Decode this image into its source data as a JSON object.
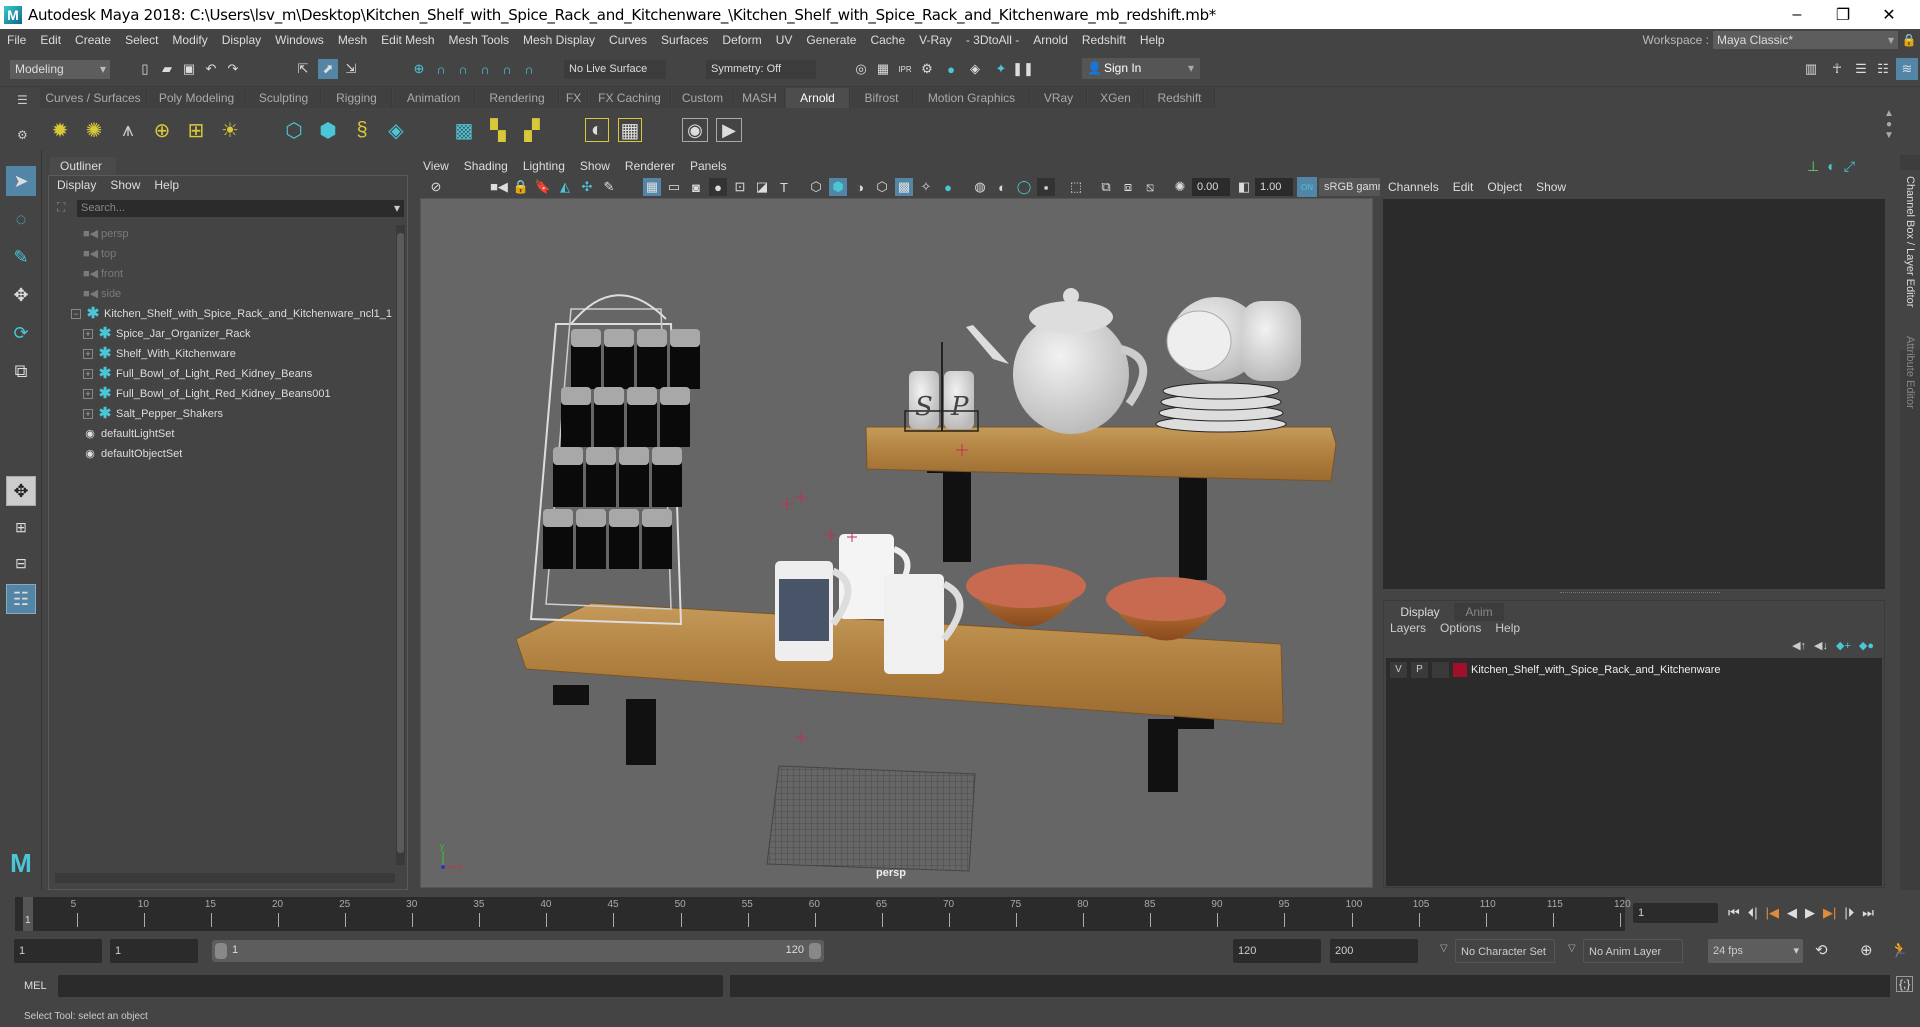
{
  "window": {
    "title": "Autodesk Maya 2018: C:\\Users\\lsv_m\\Desktop\\Kitchen_Shelf_with_Spice_Rack_and_Kitchenware_\\Kitchen_Shelf_with_Spice_Rack_and_Kitchenware_mb_redshift.mb*",
    "minimize": "–",
    "maximize": "❐",
    "close": "✕"
  },
  "menubar": {
    "items": [
      "File",
      "Edit",
      "Create",
      "Select",
      "Modify",
      "Display",
      "Windows",
      "Mesh",
      "Edit Mesh",
      "Mesh Tools",
      "Mesh Display",
      "Curves",
      "Surfaces",
      "Deform",
      "UV",
      "Generate",
      "Cache",
      "V-Ray",
      "- 3DtoAll -",
      "Arnold",
      "Redshift",
      "Help"
    ],
    "workspace_label": "Workspace :",
    "workspace_value": "Maya Classic*"
  },
  "statusline": {
    "mode": "Modeling",
    "live_surface": "No Live Surface",
    "symmetry": "Symmetry: Off",
    "sign_in": "Sign In"
  },
  "shelf": {
    "tabs": [
      "Curves / Surfaces",
      "Poly Modeling",
      "Sculpting",
      "Rigging",
      "Animation",
      "Rendering",
      "FX",
      "FX Caching",
      "Custom",
      "MASH",
      "Arnold",
      "Bifrost",
      "Motion Graphics",
      "VRay",
      "XGen",
      "Redshift"
    ],
    "active_tab": "Arnold"
  },
  "outliner": {
    "tab": "Outliner",
    "menu": [
      "Display",
      "Show",
      "Help"
    ],
    "search_placeholder": "Search...",
    "cameras": [
      "persp",
      "top",
      "front",
      "side"
    ],
    "root": "Kitchen_Shelf_with_Spice_Rack_and_Kitchenware_ncl1_1",
    "children": [
      "Spice_Jar_Organizer_Rack",
      "Shelf_With_Kitchenware",
      "Full_Bowl_of_Light_Red_Kidney_Beans",
      "Full_Bowl_of_Light_Red_Kidney_Beans001",
      "Salt_Pepper_Shakers"
    ],
    "sets": [
      "defaultLightSet",
      "defaultObjectSet"
    ]
  },
  "viewport": {
    "menu": [
      "View",
      "Shading",
      "Lighting",
      "Show",
      "Renderer",
      "Panels"
    ],
    "exposure": "0.00",
    "gamma": "1.00",
    "color_space": "sRGB gamma",
    "camera_label": "persp",
    "shaker_letters": [
      "S",
      "P"
    ]
  },
  "channelbox": {
    "menu": [
      "Channels",
      "Edit",
      "Object",
      "Show"
    ],
    "side_tabs": [
      "Channel Box / Layer Editor",
      "Attribute Editor"
    ]
  },
  "layers": {
    "tabs": [
      "Display",
      "Anim"
    ],
    "active_tab": "Display",
    "menu": [
      "Layers",
      "Options",
      "Help"
    ],
    "rows": [
      {
        "v": "V",
        "p": "P",
        "color": "#a0102a",
        "name": "Kitchen_Shelf_with_Spice_Rack_and_Kitchenware"
      }
    ]
  },
  "timeline": {
    "ticks": [
      5,
      10,
      15,
      20,
      25,
      30,
      35,
      40,
      45,
      50,
      55,
      60,
      65,
      70,
      75,
      80,
      85,
      90,
      95,
      100,
      105,
      110,
      115,
      120
    ],
    "start": 1,
    "end": 120,
    "current_frame": "1",
    "current_marker": "1"
  },
  "range": {
    "start": "1",
    "anim_start": "1",
    "slider_start": "1",
    "slider_end": "120",
    "end": "120",
    "anim_end": "200",
    "character_set": "No Character Set",
    "anim_layer": "No Anim Layer",
    "fps": "24 fps"
  },
  "mel": {
    "label": "MEL"
  },
  "help_line": "Select Tool: select an object",
  "colors": {
    "accent": "#5285a6",
    "teal": "#4bc6d6",
    "key_orange": "#e08a3c"
  }
}
